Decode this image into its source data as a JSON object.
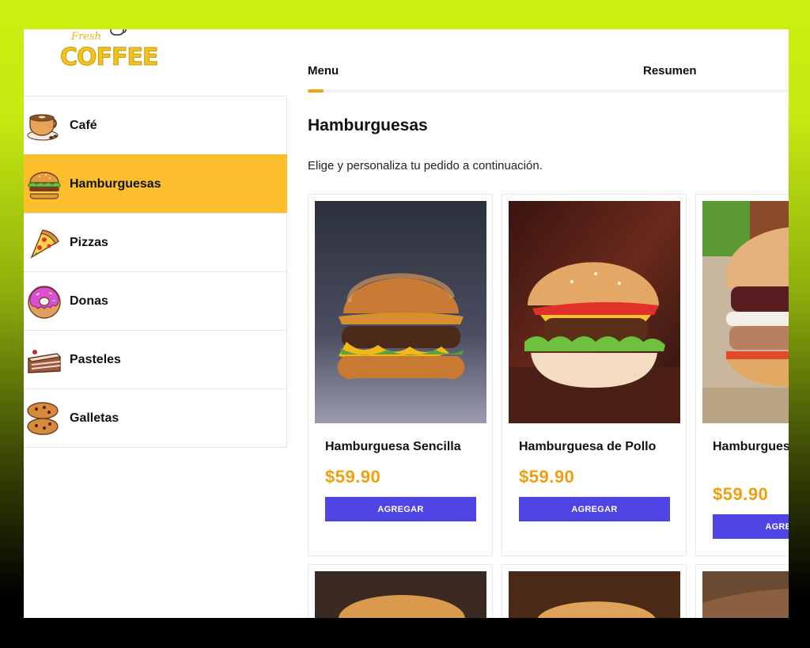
{
  "brand": {
    "name": "COFFEE",
    "script": "Fresh"
  },
  "tabs": [
    {
      "label": "Menu"
    },
    {
      "label": "Resumen"
    }
  ],
  "progress": {
    "fraction": 0.033
  },
  "sidebar": {
    "items": [
      {
        "label": "Café",
        "icon": "coffee-cup-icon",
        "active": false
      },
      {
        "label": "Hamburguesas",
        "icon": "burger-icon",
        "active": true
      },
      {
        "label": "Pizzas",
        "icon": "pizza-slice-icon",
        "active": false
      },
      {
        "label": "Donas",
        "icon": "donut-icon",
        "active": false
      },
      {
        "label": "Pasteles",
        "icon": "cake-slice-icon",
        "active": false
      },
      {
        "label": "Galletas",
        "icon": "cookies-icon",
        "active": false
      }
    ]
  },
  "main": {
    "title": "Hamburguesas",
    "subtitle": "Elige y personaliza tu pedido a continuación.",
    "products": [
      {
        "name": "Hamburguesa Sencilla",
        "price": "$59.90",
        "button": "AGREGAR"
      },
      {
        "name": "Hamburguesa de Pollo",
        "price": "$59.90",
        "button": "AGREGAR"
      },
      {
        "name": "Hamburguesa Chili",
        "price": "$59.90",
        "button": "AGREGAR"
      }
    ]
  },
  "colors": {
    "accent": "#fdbf2d",
    "price": "#f29d0d",
    "button": "#4f45e4",
    "progress": "#f2a20c"
  }
}
